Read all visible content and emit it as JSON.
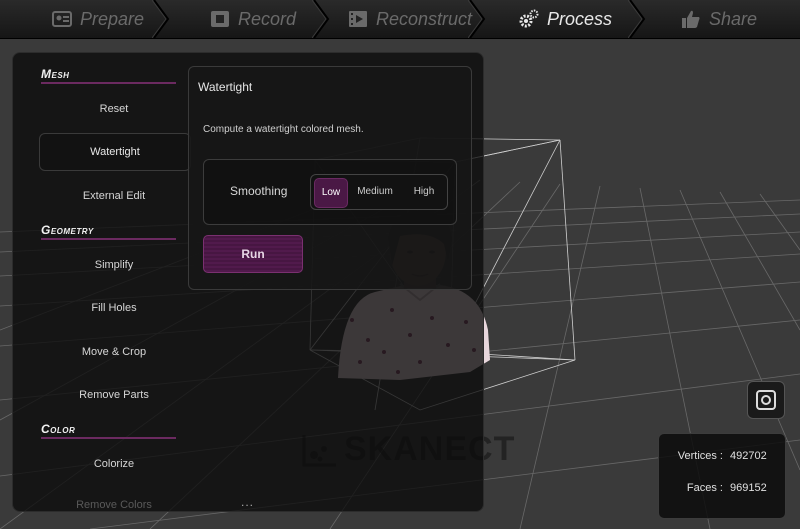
{
  "nav": {
    "steps": [
      {
        "label": "Prepare",
        "icon": "id-card-icon",
        "active": false
      },
      {
        "label": "Record",
        "icon": "film-camera-icon",
        "active": false
      },
      {
        "label": "Reconstruct",
        "icon": "film-strip-icon",
        "active": false
      },
      {
        "label": "Process",
        "icon": "gears-icon",
        "active": true
      },
      {
        "label": "Share",
        "icon": "thumbs-up-icon",
        "active": false
      }
    ]
  },
  "sidebar": {
    "sections": [
      {
        "title": "Mesh",
        "items": [
          "Reset",
          "Watertight",
          "External Edit"
        ]
      },
      {
        "title": "Geometry",
        "items": [
          "Simplify",
          "Fill Holes",
          "Move & Crop",
          "Remove Parts"
        ]
      },
      {
        "title": "Color",
        "items": [
          "Colorize",
          "Remove Colors"
        ]
      }
    ],
    "selected_item": "Watertight",
    "more_indicator": "..."
  },
  "panel": {
    "title": "Watertight",
    "description": "Compute a watertight colored mesh.",
    "smoothing": {
      "label": "Smoothing",
      "options": [
        "Low",
        "Medium",
        "High"
      ],
      "selected": "Low"
    },
    "run_label": "Run"
  },
  "watermark": {
    "text": "SKANECT"
  },
  "stats": {
    "vertices_label": "Vertices :",
    "vertices_value": "492702",
    "faces_label": "Faces :",
    "faces_value": "969152"
  },
  "colors": {
    "accent": "#4a1845",
    "accent_border": "#6b2a60",
    "background": "#3a3a3a"
  }
}
